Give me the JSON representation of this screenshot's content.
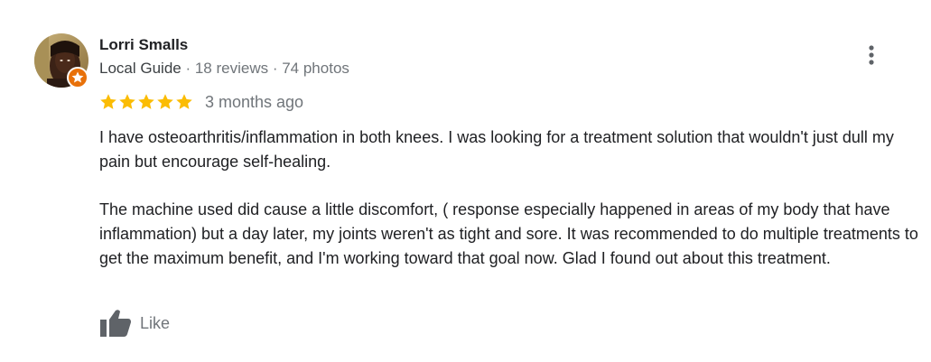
{
  "review": {
    "author": "Lorri Smalls",
    "guide_label": "Local Guide",
    "reviews_count": "18 reviews",
    "photos_count": "74 photos",
    "separator": " · ",
    "rating": 5,
    "rating_max": 5,
    "time_ago": "3 months ago",
    "paragraphs": [
      "I have osteoarthritis/inflammation in both knees. I was looking for a treatment solution that wouldn't just dull my pain but encourage self-healing.",
      "The machine used did cause a little discomfort, ( response especially happened  in areas of my body that have inflammation) but a day later, my joints weren't as tight and sore. It was recommended to do multiple treatments to get the maximum benefit, and I'm working toward that goal now. Glad I found out about this treatment."
    ],
    "like_label": "Like"
  },
  "icons": {
    "more": "more-vert-icon",
    "like": "thumb-up-icon",
    "badge": "local-guide-star-icon",
    "star": "star-icon"
  },
  "colors": {
    "star": "#fbbc04",
    "badge": "#e8710a",
    "muted": "#70757a",
    "text": "#202124"
  }
}
